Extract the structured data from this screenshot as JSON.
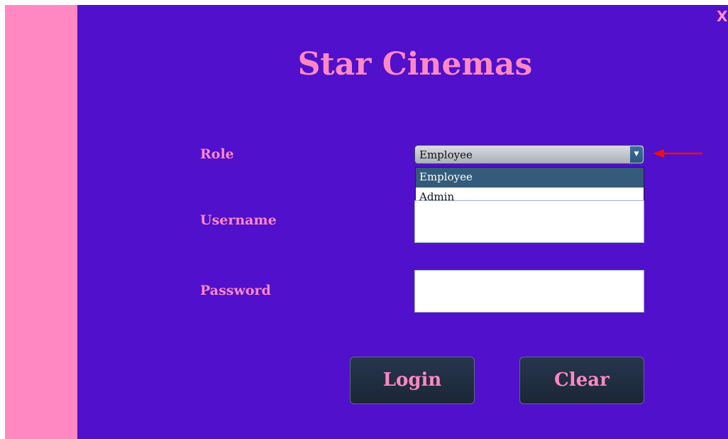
{
  "window": {
    "close_label": "X"
  },
  "header": {
    "title": "Star Cinemas"
  },
  "form": {
    "role_label": "Role",
    "role_selected": "Employee",
    "role_options": [
      "Employee",
      "Admin"
    ],
    "username_label": "Username",
    "username_value": "",
    "password_label": "Password",
    "password_value": ""
  },
  "buttons": {
    "login": "Login",
    "clear": "Clear"
  },
  "colors": {
    "main_background": "#5010cc",
    "side_panel": "#ff88c2",
    "accent_text": "#ff88c4",
    "button_background": "#1f2b3e",
    "selected_option": "#345b7a",
    "annotation_arrow": "#e81010"
  },
  "icons": {
    "dropdown_arrow": "triangle-down-icon",
    "annotation": "red-arrow-icon"
  }
}
